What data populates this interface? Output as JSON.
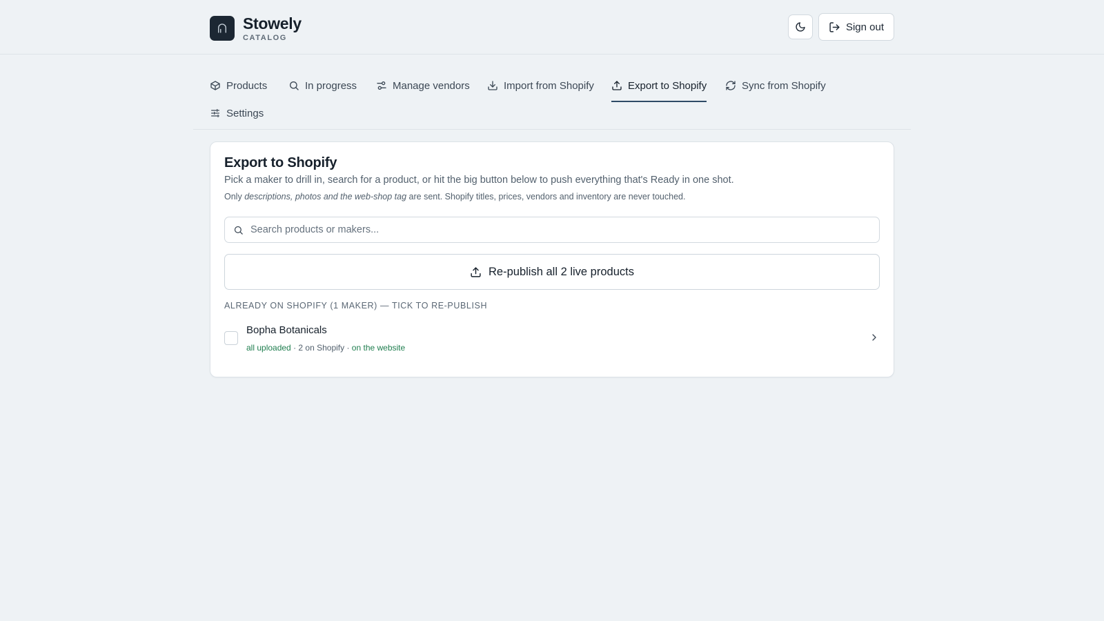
{
  "app": {
    "name": "Stowely",
    "subtitle": "CATALOG",
    "sign_out_label": "Sign out"
  },
  "nav": {
    "tabs": [
      {
        "label": "Products",
        "icon": "box-icon"
      },
      {
        "label": "In progress",
        "icon": "search-icon"
      },
      {
        "label": "Manage vendors",
        "icon": "sliders-icon"
      },
      {
        "label": "Import from Shopify",
        "icon": "download-icon"
      },
      {
        "label": "Export to Shopify",
        "icon": "upload-icon",
        "active": true
      },
      {
        "label": "Sync from Shopify",
        "icon": "refresh-icon"
      },
      {
        "label": "Settings",
        "icon": "settings-sliders-icon"
      }
    ]
  },
  "export": {
    "title": "Export to Shopify",
    "description": "Pick a maker to drill in, search for a product, or hit the big button below to push everything that's Ready in one shot.",
    "note_prefix": "Only ",
    "note_emphasis": "descriptions, photos and the web-shop tag",
    "note_suffix": " are sent. Shopify titles, prices, vendors and inventory are never touched.",
    "search_placeholder": "Search products or makers...",
    "republish_label": "Re-publish all 2 live products",
    "section_label": "ALREADY ON SHOPIFY (1 MAKER) — TICK TO RE-PUBLISH",
    "makers": [
      {
        "name": "Bopha Botanicals",
        "status": "all uploaded",
        "separator": " · ",
        "count": "2 on Shopify",
        "website": "on the website"
      }
    ]
  },
  "colors": {
    "accent": "#2d4a66",
    "success": "#1e7d4e",
    "logo_bg": "#1c2733"
  }
}
